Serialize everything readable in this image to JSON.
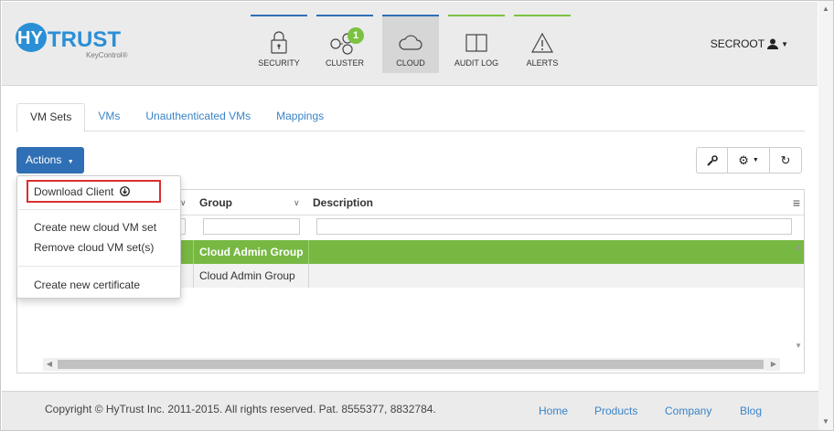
{
  "brand": {
    "logo_text": "HYTRUST",
    "logo_sub": "KeyControl®",
    "accent": "#2f6fb5",
    "logo_color": "#2a8fd6"
  },
  "nav": [
    {
      "label": "SECURITY",
      "icon": "lock-icon",
      "bar_color": "#2f6fb5"
    },
    {
      "label": "CLUSTER",
      "icon": "cluster-icon",
      "bar_color": "#2f6fb5",
      "badge": "1"
    },
    {
      "label": "CLOUD",
      "icon": "cloud-icon",
      "bar_color": "#2f6fb5",
      "active": true
    },
    {
      "label": "AUDIT LOG",
      "icon": "book-icon",
      "bar_color": "#7cc242"
    },
    {
      "label": "ALERTS",
      "icon": "warning-icon",
      "bar_color": "#7cc242"
    }
  ],
  "user": {
    "name": "SECROOT"
  },
  "tabs": [
    "VM Sets",
    "VMs",
    "Unauthenticated VMs",
    "Mappings"
  ],
  "actions": {
    "label": "Actions"
  },
  "dropdown": {
    "items": [
      "Download Client",
      "Create new cloud VM set",
      "Remove cloud VM set(s)",
      "Create new certificate"
    ]
  },
  "grid": {
    "columns": [
      "Group",
      "Description"
    ],
    "rows": [
      {
        "group": "Cloud Admin Group",
        "selected": true
      },
      {
        "group": "Cloud Admin Group",
        "selected": false
      }
    ],
    "selected_color": "#77b843"
  },
  "footer": {
    "copyright": "Copyright © HyTrust Inc. 2011-2015. All rights reserved. Pat. 8555377, 8832784.",
    "links": [
      "Home",
      "Products",
      "Company",
      "Blog"
    ]
  }
}
